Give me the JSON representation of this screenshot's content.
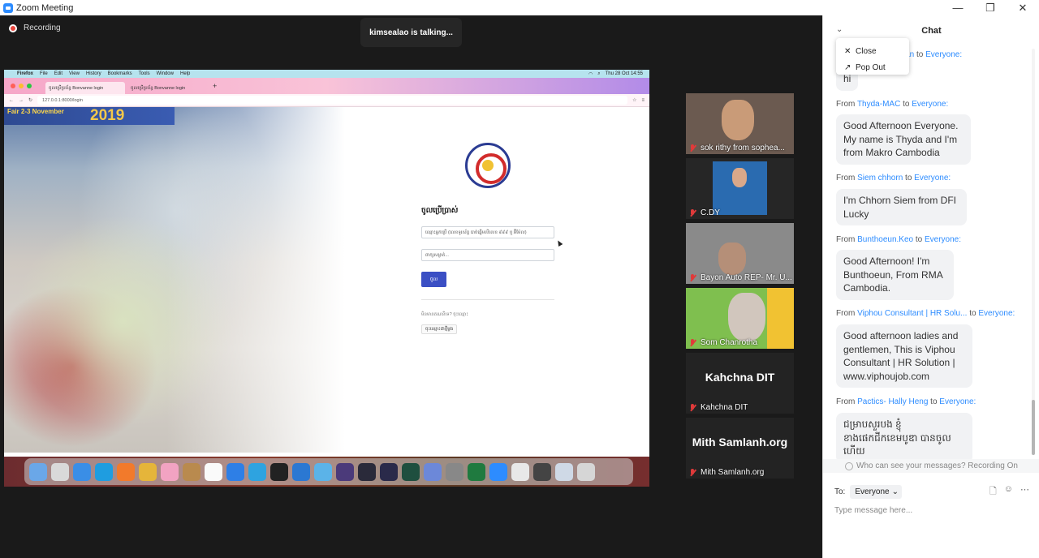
{
  "window": {
    "title": "Zoom Meeting",
    "minimize": "—",
    "maximize": "❐",
    "close": "✕"
  },
  "meeting": {
    "recording_label": "Recording",
    "talking_label": "kimsealao is talking..."
  },
  "shared_screen": {
    "mac_menu": [
      "Firefox",
      "File",
      "Edit",
      "View",
      "History",
      "Bookmarks",
      "Tools",
      "Window",
      "Help"
    ],
    "clock": "Thu 28 Oct 14:55",
    "tabs": [
      "ចូលប្រើប្រព័ន្ធ Bonvanne login",
      "ចូលប្រើប្រព័ន្ធ Bonvanne login"
    ],
    "url": "127.0.0.1:8000/login",
    "banner_line1": "Fair 2-3 November",
    "banner_year": "2019",
    "login_title": "ចូលប្រើប្រាស់",
    "username_placeholder": "ឈ្មោះអ្នកប្រើ (លេខទូរស័ព្ទ បាច់ឆ្នើមលីលេខ ៩៩៩ ឬ អ៊ីម៉ែល)",
    "password_placeholder": "ពាក្យសម្ងាត់...",
    "login_button": "ចូល",
    "forgot_text": "មិនមានគណនីទេ? ចុះឈ្មោះ",
    "register_button": "ចុះឈ្មោះជាថ្មីម្ដង"
  },
  "participants": [
    {
      "name": "sok rithy from sophea...",
      "style": "video"
    },
    {
      "name": "C.DY",
      "style": "video"
    },
    {
      "name": "Bayon Auto REP- Mr. U...",
      "style": "video"
    },
    {
      "name": "Som Chanrotha",
      "style": "video"
    },
    {
      "name": "Kahchna DIT",
      "big": "Kahchna DIT",
      "style": "text"
    },
    {
      "name": "Mith Samlanh.org",
      "big": "Mith Samlanh.org",
      "style": "text"
    }
  ],
  "chat": {
    "title": "Chat",
    "menu": {
      "close": "Close",
      "pop_out": "Pop Out"
    },
    "messages": [
      {
        "from_prefix": "From",
        "sender": "Wan",
        "to_prefix": "to",
        "recipient": "Everyone:",
        "text": "hi"
      },
      {
        "from_prefix": "From",
        "sender": "Thyda-MAC",
        "to_prefix": "to",
        "recipient": "Everyone:",
        "text": "Good Afternoon Everyone. My name is Thyda and I'm from Makro Cambodia"
      },
      {
        "from_prefix": "From",
        "sender": "Siem chhorn",
        "to_prefix": "to",
        "recipient": "Everyone:",
        "text": "I'm Chhorn Siem from DFI Lucky"
      },
      {
        "from_prefix": "From",
        "sender": "Bunthoeun.Keo",
        "to_prefix": "to",
        "recipient": "Everyone:",
        "text": "Good Afternoon! I'm Bunthoeun, From RMA Cambodia."
      },
      {
        "from_prefix": "From",
        "sender": "Viphou Consultant | HR Solu...",
        "to_prefix": "to",
        "recipient": "Everyone:",
        "text": "Good afternoon ladies and gentlemen, This is Viphou Consultant | HR Solution | www.viphoujob.com"
      },
      {
        "from_prefix": "From",
        "sender": "Pactics- Hally Heng",
        "to_prefix": "to",
        "recipient": "Everyone:",
        "text": "ជម្រាបសួរបង ខ្ញុំខាងផេកជីកខេមបូឌា បានចូលហើយ"
      }
    ],
    "visibility_note": "Who can see your messages? Recording On",
    "to_label": "To:",
    "to_value": "Everyone",
    "input_placeholder": "Type message here..."
  }
}
